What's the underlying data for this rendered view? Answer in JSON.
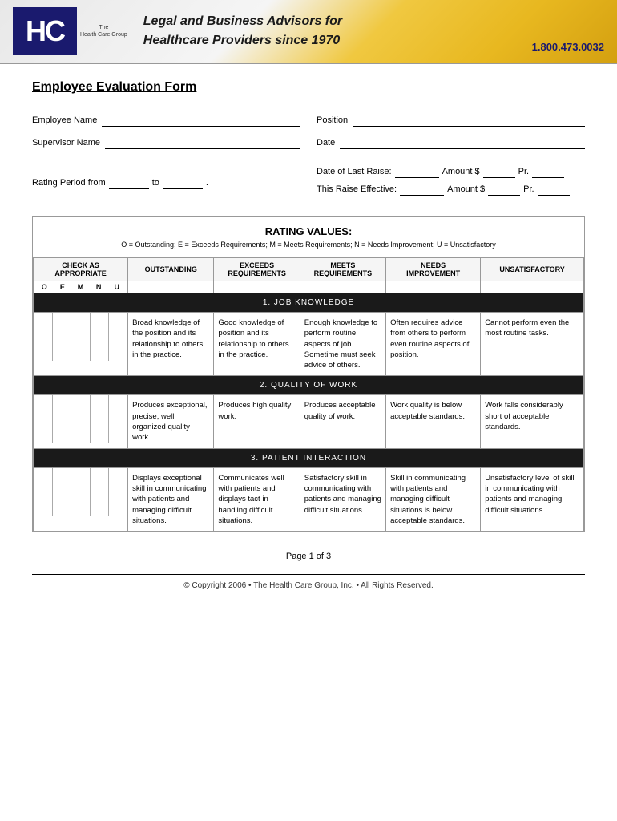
{
  "header": {
    "logo_text": "HC",
    "logo_sub_line1": "The",
    "logo_sub_line2": "Health Care Group",
    "tagline_line1": "Legal and Business Advisors for",
    "tagline_line2": "Healthcare Providers since 1970",
    "phone": "1.800.473.0032"
  },
  "form": {
    "title": "Employee Evaluation Form",
    "fields": {
      "employee_name_label": "Employee Name",
      "position_label": "Position",
      "supervisor_name_label": "Supervisor Name",
      "date_label": "Date"
    },
    "rating_period": {
      "label": "Rating Period from",
      "from_blank": "",
      "to_label": "to",
      "to_blank": ""
    },
    "last_raise": {
      "label": "Date of Last Raise:",
      "amount_label": "Amount $",
      "pr_label": "Pr."
    },
    "this_raise": {
      "label": "This Raise Effective:",
      "amount_label": "Amount $",
      "pr_label": "Pr."
    }
  },
  "rating_values": {
    "title": "RATING VALUES:",
    "legend": "O = Outstanding; E = Exceeds Requirements; M = Meets Requirements; N = Needs Improvement; U = Unsatisfactory"
  },
  "table": {
    "headers": {
      "check_as": "CHECK AS",
      "appropriate": "APPROPRIATE",
      "outstanding": "OUTSTANDING",
      "exceeds": "EXCEEDS",
      "exceeds2": "REQUIREMENTS",
      "meets": "MEETS",
      "meets2": "REQUIREMENTS",
      "needs": "NEEDS",
      "needs2": "IMPROVEMENT",
      "unsatisfactory": "UNSATISFACTORY"
    },
    "letters": [
      "O",
      "E",
      "M",
      "N",
      "U"
    ],
    "sections": [
      {
        "name": "1. JOB KNOWLEDGE",
        "descriptions": {
          "outstanding": "Broad knowledge of the position and its relationship to others in the practice.",
          "exceeds": "Good knowledge of position and its relationship to others in the practice.",
          "meets": "Enough knowledge to perform routine aspects of job. Sometime must seek advice of others.",
          "needs": "Often requires advice from others to perform even routine aspects of position.",
          "unsatisfactory": "Cannot perform even the most routine tasks."
        }
      },
      {
        "name": "2. QUALITY OF WORK",
        "descriptions": {
          "outstanding": "Produces exceptional, precise, well organized quality work.",
          "exceeds": "Produces high quality work.",
          "meets": "Produces acceptable quality of work.",
          "needs": "Work quality is below acceptable standards.",
          "unsatisfactory": "Work falls considerably short of acceptable standards."
        }
      },
      {
        "name": "3. PATIENT INTERACTION",
        "descriptions": {
          "outstanding": "Displays exceptional skill in communicating with patients and managing difficult situations.",
          "exceeds": "Communicates well with patients and displays tact in handling difficult situations.",
          "meets": "Satisfactory skill in communicating with patients and managing difficult situations.",
          "needs": "Skill in communicating with patients and managing difficult situations is below acceptable standards.",
          "unsatisfactory": "Unsatisfactory level of skill in communicating with patients and managing difficult situations."
        }
      }
    ]
  },
  "pagination": {
    "page_label": "Page 1 of 3"
  },
  "copyright": "© Copyright 2006 • The Health Care Group, Inc. • All Rights Reserved."
}
